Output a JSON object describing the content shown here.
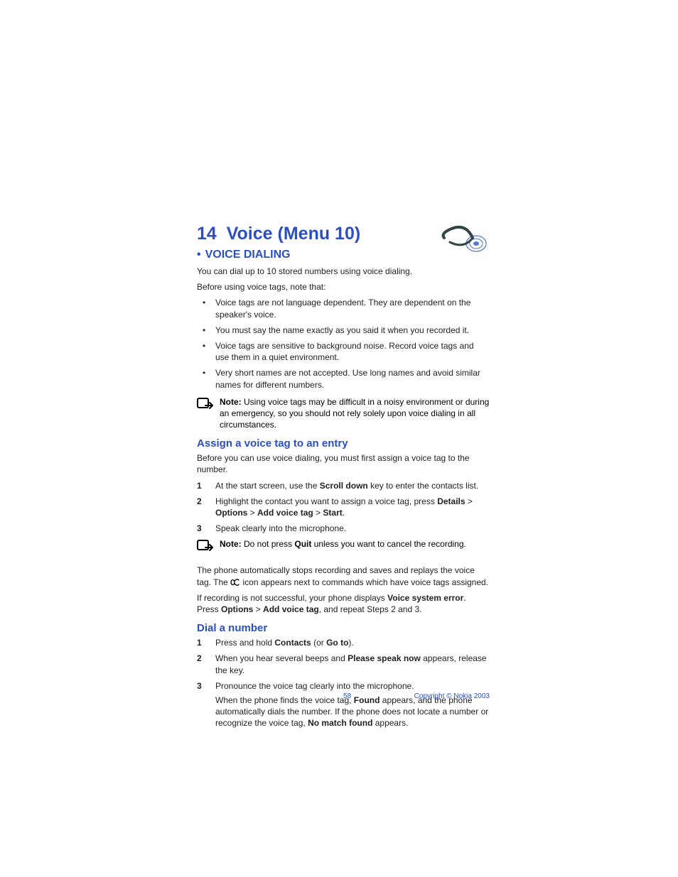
{
  "chapter": {
    "num": "14",
    "title": "Voice (Menu 10)"
  },
  "section": {
    "bullet": "•",
    "title": "VOICE DIALING"
  },
  "intro1": "You can dial up to 10 stored numbers using voice dialing.",
  "intro2": "Before using voice tags, note that:",
  "bullets": [
    "Voice tags are not language dependent. They are dependent on the speaker's voice.",
    "You must say the name exactly as you said it when you recorded it.",
    "Voice tags are sensitive to background noise. Record voice tags and use them in a quiet environment.",
    "Very short names are not accepted. Use long names and avoid similar names for different numbers."
  ],
  "note1": {
    "label": "Note:",
    "text": " Using voice tags may be difficult in a noisy environment or during an emergency, so you should not rely solely upon voice dialing in all circumstances."
  },
  "sub1": {
    "title": "Assign a voice tag to an entry",
    "lead": "Before you can use voice dialing, you must first assign a voice tag to the number."
  },
  "steps1": {
    "s1a": "At the start screen, use the ",
    "s1b": "Scroll down",
    "s1c": " key to enter the contacts list.",
    "s2a": "Highlight the contact you want to assign a voice tag, press ",
    "s2b": "Details",
    "s2c": " > ",
    "s2d": "Options",
    "s2e": " > ",
    "s2f": "Add voice tag",
    "s2g": " > ",
    "s2h": "Start",
    "s2i": ".",
    "s3": "Speak clearly into the microphone."
  },
  "note2": {
    "label": "Note:",
    "text1": " Do not press ",
    "quit": "Quit",
    "text2": " unless you want to cancel the recording."
  },
  "after1a": "The phone automatically stops recording and saves and replays the voice tag. The ",
  "after1b": " icon appears next to commands which have voice tags assigned.",
  "after2a": "If recording is not successful, your phone displays ",
  "after2b": "Voice system error",
  "after2c": ". Press ",
  "after2d": "Options",
  "after2e": " > ",
  "after2f": "Add voice tag",
  "after2g": ", and repeat Steps 2 and 3.",
  "sub2": {
    "title": "Dial a number"
  },
  "steps2": {
    "s1a": "Press and hold ",
    "s1b": "Contacts",
    "s1c": " (or ",
    "s1d": "Go to",
    "s1e": ").",
    "s2a": "When you hear several beeps and ",
    "s2b": "Please speak now",
    "s2c": " appears, release the key.",
    "s3": "Pronounce the voice tag clearly into the microphone.",
    "s3ba": "When the phone finds the voice tag, ",
    "s3bb": "Found",
    "s3bc": " appears, and the phone automatically dials the number. If the phone does not locate a number or recognize the voice tag, ",
    "s3bd": "No match found",
    "s3be": " appears."
  },
  "nums": {
    "n1": "1",
    "n2": "2",
    "n3": "3"
  },
  "footer": {
    "page": "58",
    "copy": "Copyright © Nokia 2003"
  }
}
